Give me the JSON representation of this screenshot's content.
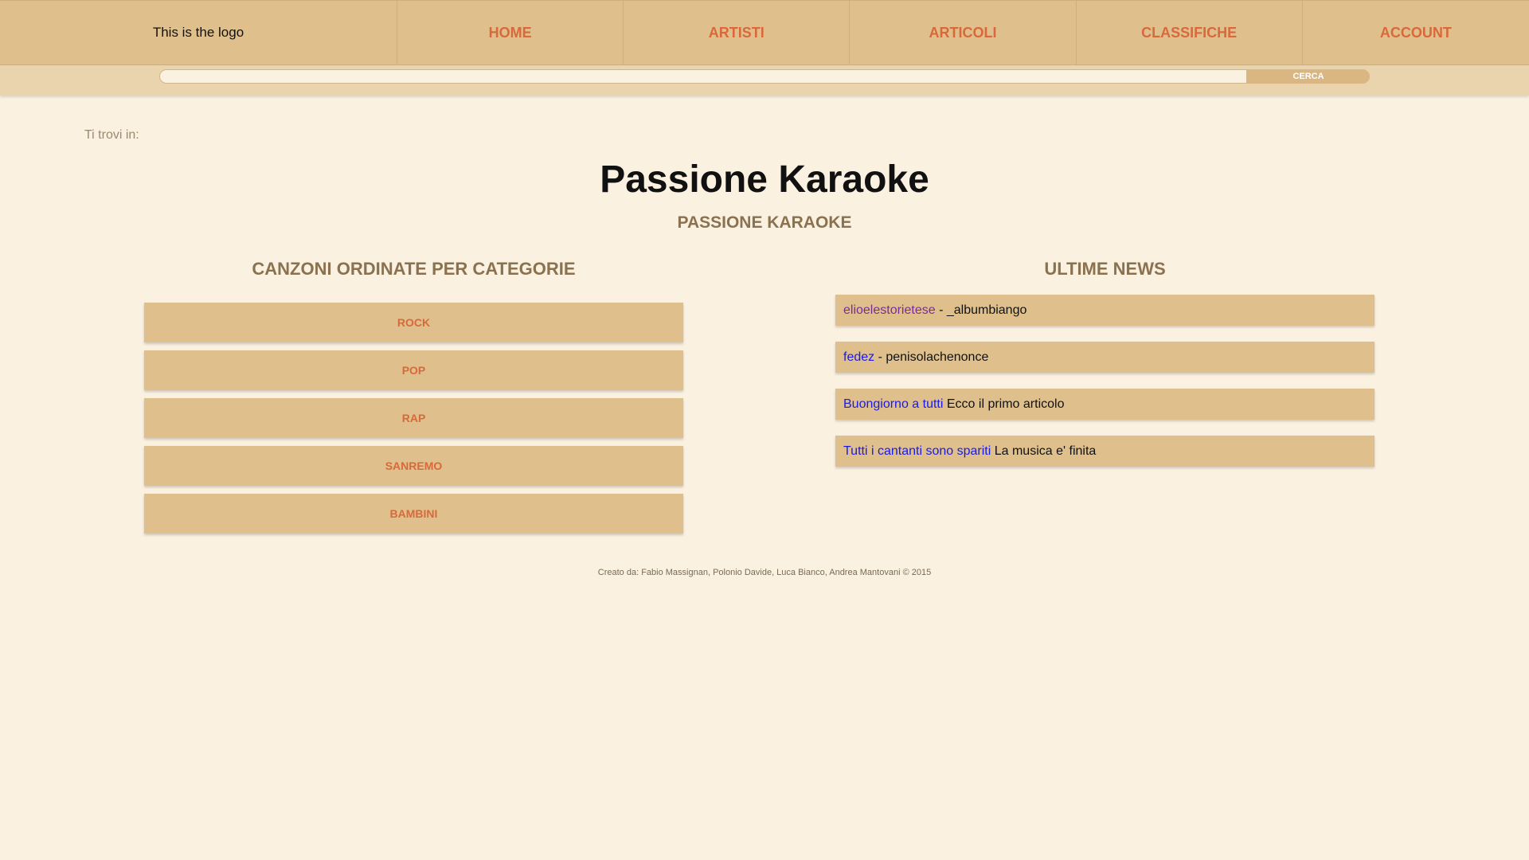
{
  "header": {
    "logo_text": "This is the logo",
    "nav": [
      "HOME",
      "ARTISTI",
      "ARTICOLI",
      "CLASSIFICHE",
      "ACCOUNT"
    ]
  },
  "search": {
    "value": "",
    "button_label": "CERCA"
  },
  "breadcrumb": "Ti trovi in:",
  "page": {
    "title": "Passione Karaoke",
    "subtitle": "PASSIONE KARAOKE"
  },
  "categories": {
    "heading": "CANZONI ORDINATE PER CATEGORIE",
    "items": [
      "ROCK",
      "POP",
      "RAP",
      "SANREMO",
      "BAMBINI"
    ]
  },
  "news": {
    "heading": "ULTIME NEWS",
    "items": [
      {
        "link": "elioelestorietese",
        "sep": " - ",
        "text": "_albumbiango"
      },
      {
        "link": "fedez",
        "sep": " - ",
        "text": "penisolachenonce"
      },
      {
        "link": "Buongiorno a tutti",
        "sep": " ",
        "text": "Ecco il primo articolo"
      },
      {
        "link": "Tutti i cantanti sono spariti",
        "sep": " ",
        "text": "La musica e' finita"
      }
    ]
  },
  "footer": "Creato da: Fabio Massignan, Polonio Davide, Luca Bianco, Andrea Mantovani © 2015",
  "colors": {
    "background": "#fbf1e0",
    "nav_background": "#dfc08c",
    "accent": "#d9683a",
    "heading": "#8a7150",
    "link": "#1a1ae6",
    "visited_link": "#7a2a9a"
  }
}
